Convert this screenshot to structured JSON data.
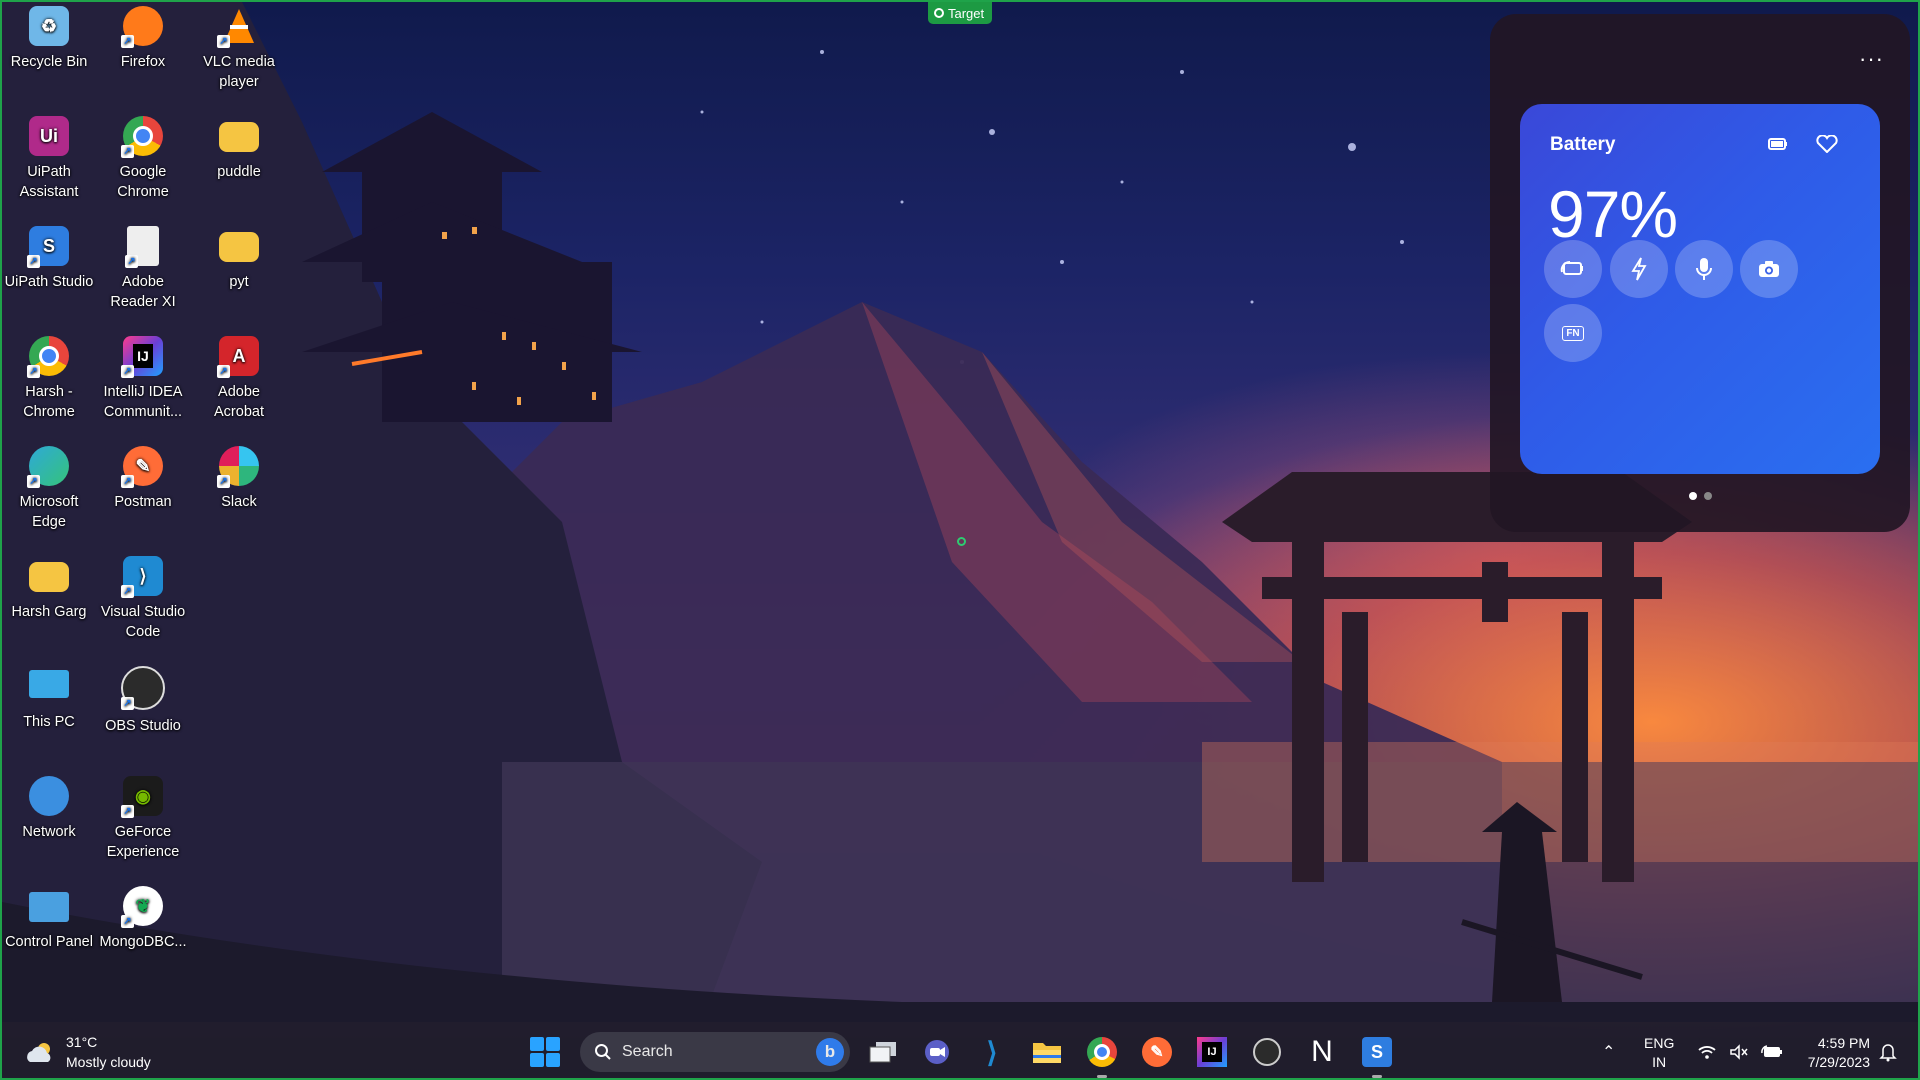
{
  "overlay": {
    "target_label": "Target"
  },
  "desktop_icons": [
    {
      "label": "Recycle Bin",
      "icon": "recycle-bin-icon",
      "color": "#6fb7e8"
    },
    {
      "label": "Firefox",
      "icon": "firefox-icon",
      "color": "#ff7a1a"
    },
    {
      "label": "VLC media player",
      "icon": "vlc-icon",
      "color": "#ff8800"
    },
    {
      "label": "UiPath Assistant",
      "icon": "uipath-assistant-icon",
      "color": "#b02a8a"
    },
    {
      "label": "Google Chrome",
      "icon": "chrome-icon",
      "color": "#e8453c"
    },
    {
      "label": "puddle",
      "icon": "folder-icon",
      "color": "#f5c542"
    },
    {
      "label": "UiPath Studio",
      "icon": "uipath-studio-icon",
      "color": "#2e7de0"
    },
    {
      "label": "Adobe Reader XI",
      "icon": "document-icon",
      "color": "#eeeeee"
    },
    {
      "label": "pyt",
      "icon": "folder-icon",
      "color": "#f5c542"
    },
    {
      "label": "Harsh - Chrome",
      "icon": "chrome-profile-icon",
      "color": "#e8453c"
    },
    {
      "label": "IntelliJ IDEA Communit...",
      "icon": "intellij-icon",
      "color": "#6b3fd6"
    },
    {
      "label": "Adobe Acrobat",
      "icon": "acrobat-icon",
      "color": "#d4252b"
    },
    {
      "label": "Microsoft Edge",
      "icon": "edge-icon",
      "color": "#2ea9d8"
    },
    {
      "label": "Postman",
      "icon": "postman-icon",
      "color": "#ff6c37"
    },
    {
      "label": "Slack",
      "icon": "slack-icon",
      "color": "#f2f2f2"
    },
    {
      "label": "Harsh Garg",
      "icon": "folder-icon",
      "color": "#f5c542"
    },
    {
      "label": "Visual Studio Code",
      "icon": "vscode-icon",
      "color": "#1f8ad2"
    },
    {
      "label": "This PC",
      "icon": "monitor-icon",
      "color": "#39a9e6"
    },
    {
      "label": "OBS Studio",
      "icon": "obs-icon",
      "color": "#2b2b2b"
    },
    {
      "label": "Network",
      "icon": "network-icon",
      "color": "#3b8fe0"
    },
    {
      "label": "GeForce Experience",
      "icon": "geforce-icon",
      "color": "#76b900"
    },
    {
      "label": "Control Panel",
      "icon": "control-panel-icon",
      "color": "#4aa0e0"
    },
    {
      "label": "MongoDBC...",
      "icon": "mongodb-icon",
      "color": "#ffffff"
    }
  ],
  "battery_widget": {
    "title": "Battery",
    "percent": "97%",
    "buttons": [
      "battery-saver-icon",
      "lightning-icon",
      "microphone-icon",
      "camera-icon",
      "fn-key-icon"
    ],
    "fn_label": "FN",
    "pages": 2,
    "active_page": 1
  },
  "taskbar": {
    "weather": {
      "temp": "31°C",
      "condition": "Mostly cloudy"
    },
    "search_placeholder": "Search",
    "bing_label": "b",
    "pinned_apps": [
      "task-view-icon",
      "teams-chat-icon",
      "vscode-icon",
      "file-explorer-icon",
      "chrome-icon",
      "postman-icon",
      "intellij-icon",
      "obs-icon",
      "notion-icon",
      "uipath-studio-icon"
    ],
    "language": {
      "line1": "ENG",
      "line2": "IN"
    },
    "clock": {
      "time": "4:59 PM",
      "date": "7/29/2023"
    }
  }
}
